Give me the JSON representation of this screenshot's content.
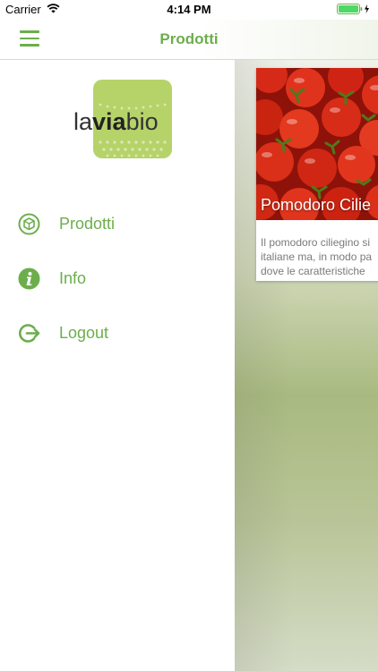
{
  "status_bar": {
    "carrier": "Carrier",
    "time": "4:14 PM"
  },
  "nav": {
    "title": "Prodotti",
    "menu_icon": "hamburger-icon",
    "accent_color": "#6cae4c"
  },
  "drawer": {
    "logo_text_parts": [
      "la",
      "via",
      "bio"
    ],
    "items": [
      {
        "label": "Prodotti",
        "icon": "box-icon"
      },
      {
        "label": "Info",
        "icon": "info-icon"
      },
      {
        "label": "Logout",
        "icon": "logout-icon"
      }
    ]
  },
  "main": {
    "product": {
      "title": "Pomodoro Cilie",
      "description_lines": [
        "Il pomodoro ciliegino si",
        "italiane ma, in modo pa",
        "dove le caratteristiche"
      ]
    }
  }
}
